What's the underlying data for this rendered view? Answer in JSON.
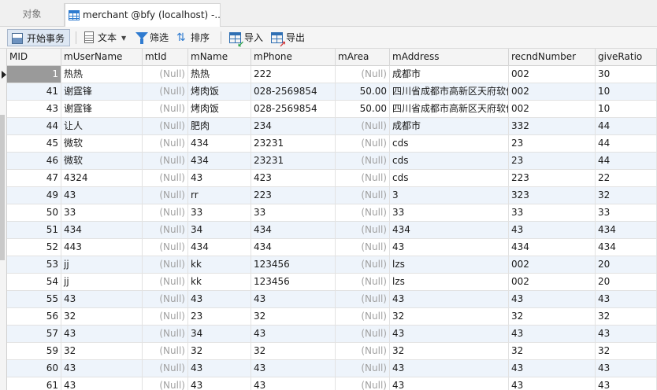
{
  "tabs": {
    "objects_label": "对象",
    "active_label": "merchant @bfy (localhost) -..."
  },
  "toolbar": {
    "begin_transaction": "开始事务",
    "text": "文本",
    "filter": "筛选",
    "sort": "排序",
    "import": "导入",
    "export": "导出"
  },
  "columns": [
    "MID",
    "mUserName",
    "mtId",
    "mName",
    "mPhone",
    "mArea",
    "mAddress",
    "recndNumber",
    "giveRatio"
  ],
  "rows": [
    [
      "1",
      "热热",
      "(Null)",
      "热热",
      "222",
      "(Null)",
      "成都市",
      "002",
      "30"
    ],
    [
      "41",
      "谢霆锋",
      "(Null)",
      "烤肉饭",
      "028-2569854",
      "50.00",
      "四川省成都市高新区天府软件",
      "002",
      "10"
    ],
    [
      "43",
      "谢霆锋",
      "(Null)",
      "烤肉饭",
      "028-2569854",
      "50.00",
      "四川省成都市高新区天府软件",
      "002",
      "10"
    ],
    [
      "44",
      "让人",
      "(Null)",
      "肥肉",
      "234",
      "(Null)",
      "成都市",
      "332",
      "44"
    ],
    [
      "45",
      "微软",
      "(Null)",
      "434",
      "23231",
      "(Null)",
      "cds",
      "23",
      "44"
    ],
    [
      "46",
      "微软",
      "(Null)",
      "434",
      "23231",
      "(Null)",
      "cds",
      "23",
      "44"
    ],
    [
      "47",
      "4324",
      "(Null)",
      "43",
      "423",
      "(Null)",
      "cds",
      "223",
      "22"
    ],
    [
      "49",
      "43",
      "(Null)",
      "rr",
      "223",
      "(Null)",
      "3",
      "323",
      "32"
    ],
    [
      "50",
      "33",
      "(Null)",
      "33",
      "33",
      "(Null)",
      "33",
      "33",
      "33"
    ],
    [
      "51",
      "434",
      "(Null)",
      "34",
      "434",
      "(Null)",
      "434",
      "43",
      "434"
    ],
    [
      "52",
      "443",
      "(Null)",
      "434",
      "434",
      "(Null)",
      "43",
      "434",
      "434"
    ],
    [
      "53",
      "jj",
      "(Null)",
      "kk",
      "123456",
      "(Null)",
      "lzs",
      "002",
      "20"
    ],
    [
      "54",
      "jj",
      "(Null)",
      "kk",
      "123456",
      "(Null)",
      "lzs",
      "002",
      "20"
    ],
    [
      "55",
      "43",
      "(Null)",
      "43",
      "43",
      "(Null)",
      "43",
      "43",
      "43"
    ],
    [
      "56",
      "32",
      "(Null)",
      "23",
      "32",
      "(Null)",
      "32",
      "32",
      "32"
    ],
    [
      "57",
      "43",
      "(Null)",
      "34",
      "43",
      "(Null)",
      "43",
      "43",
      "43"
    ],
    [
      "59",
      "32",
      "(Null)",
      "32",
      "32",
      "(Null)",
      "32",
      "32",
      "32"
    ],
    [
      "60",
      "43",
      "(Null)",
      "43",
      "43",
      "(Null)",
      "43",
      "43",
      "43"
    ],
    [
      "61",
      "43",
      "(Null)",
      "43",
      "43",
      "(Null)",
      "43",
      "43",
      "43"
    ]
  ]
}
